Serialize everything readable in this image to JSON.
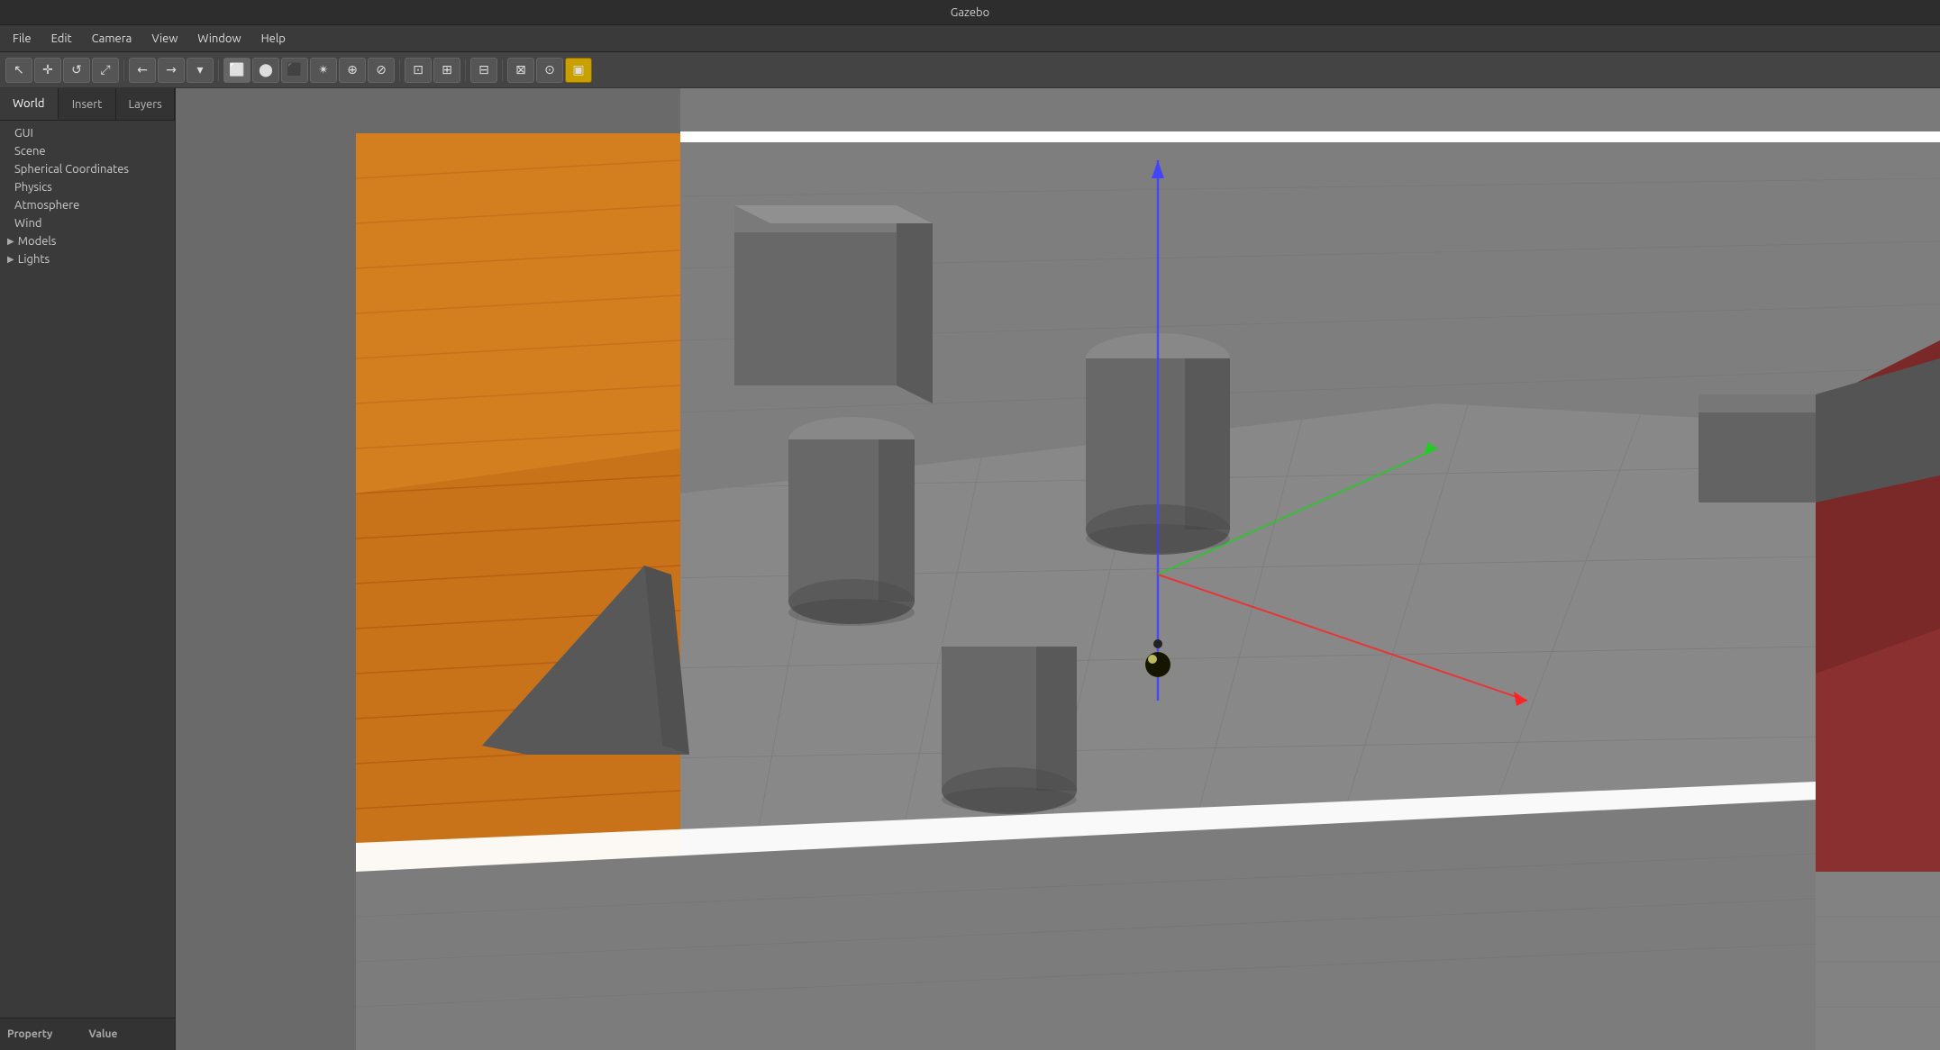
{
  "titleBar": {
    "title": "Gazebo"
  },
  "menuBar": {
    "items": [
      {
        "label": "File",
        "id": "file"
      },
      {
        "label": "Edit",
        "id": "edit"
      },
      {
        "label": "Camera",
        "id": "camera"
      },
      {
        "label": "View",
        "id": "view"
      },
      {
        "label": "Window",
        "id": "window"
      },
      {
        "label": "Help",
        "id": "help"
      }
    ]
  },
  "toolbar": {
    "buttons": [
      {
        "icon": "↖",
        "name": "select-tool",
        "tooltip": "Select mode"
      },
      {
        "icon": "✛",
        "name": "translate-tool",
        "tooltip": "Translate mode"
      },
      {
        "icon": "↺",
        "name": "rotate-tool",
        "tooltip": "Rotate mode"
      },
      {
        "icon": "⤢",
        "name": "scale-tool",
        "tooltip": "Scale mode"
      },
      {
        "icon": "←",
        "name": "undo-button",
        "tooltip": "Undo"
      },
      {
        "icon": "→",
        "name": "redo-button",
        "tooltip": "Redo"
      },
      {
        "icon": "▪",
        "name": "separator1"
      },
      {
        "icon": "⬜",
        "name": "box-tool",
        "tooltip": "Box"
      },
      {
        "icon": "⬤",
        "name": "sphere-tool",
        "tooltip": "Sphere"
      },
      {
        "icon": "⬛",
        "name": "cylinder-tool",
        "tooltip": "Cylinder"
      },
      {
        "icon": "✴",
        "name": "point-light",
        "tooltip": "Point light"
      },
      {
        "icon": "⊘",
        "name": "directional-light",
        "tooltip": "Directional light"
      },
      {
        "icon": "⊛",
        "name": "spot-light",
        "tooltip": "Spot light"
      },
      {
        "icon": "⊡",
        "name": "select-none",
        "tooltip": "Select none"
      },
      {
        "icon": "⊞",
        "name": "grid-toggle",
        "tooltip": "Grid"
      },
      {
        "icon": "⊟",
        "name": "joint-tool",
        "tooltip": "Joint"
      },
      {
        "icon": "⊠",
        "name": "save-tool",
        "tooltip": "Save world"
      },
      {
        "icon": "⊙",
        "name": "screenshot-tool",
        "tooltip": "Screenshot"
      },
      {
        "icon": "▣",
        "name": "log-tool",
        "tooltip": "Log"
      }
    ]
  },
  "leftPanel": {
    "tabs": [
      {
        "label": "World",
        "id": "world",
        "active": true
      },
      {
        "label": "Insert",
        "id": "insert"
      },
      {
        "label": "Layers",
        "id": "layers"
      }
    ],
    "worldTree": {
      "items": [
        {
          "label": "GUI",
          "indent": 1,
          "hasArrow": false
        },
        {
          "label": "Scene",
          "indent": 1,
          "hasArrow": false
        },
        {
          "label": "Spherical Coordinates",
          "indent": 1,
          "hasArrow": false
        },
        {
          "label": "Physics",
          "indent": 1,
          "hasArrow": false
        },
        {
          "label": "Atmosphere",
          "indent": 1,
          "hasArrow": false
        },
        {
          "label": "Wind",
          "indent": 1,
          "hasArrow": false
        },
        {
          "label": "Models",
          "indent": 1,
          "hasArrow": true,
          "expanded": false
        },
        {
          "label": "Lights",
          "indent": 1,
          "hasArrow": true,
          "expanded": false
        }
      ]
    },
    "propertyPanel": {
      "columns": [
        {
          "label": "Property"
        },
        {
          "label": "Value"
        }
      ]
    }
  },
  "viewport": {
    "scene": {
      "description": "3D Gazebo scene with room, boxes, cylinders, and axes"
    }
  }
}
